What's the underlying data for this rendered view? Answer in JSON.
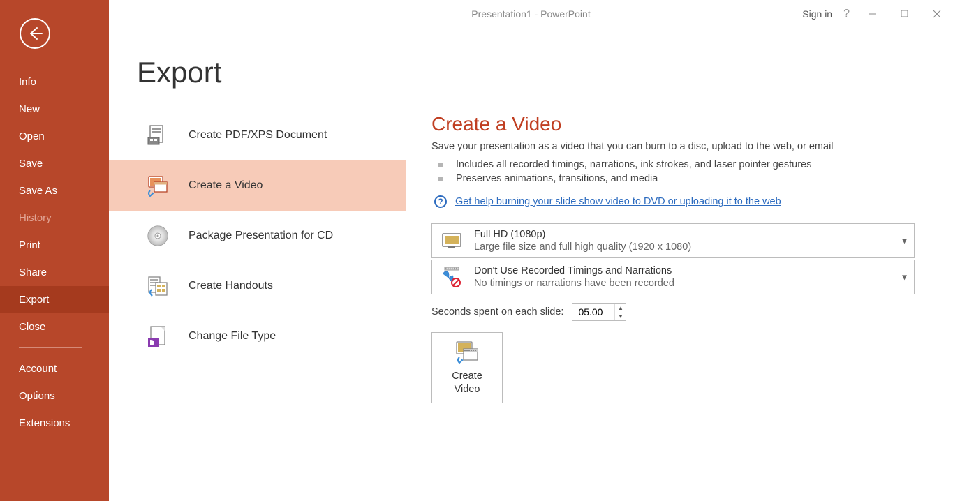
{
  "window": {
    "title": "Presentation1  -  PowerPoint",
    "signin": "Sign in",
    "help": "?"
  },
  "sidebar": {
    "items": [
      {
        "label": "Info",
        "selected": false,
        "disabled": false
      },
      {
        "label": "New",
        "selected": false,
        "disabled": false
      },
      {
        "label": "Open",
        "selected": false,
        "disabled": false
      },
      {
        "label": "Save",
        "selected": false,
        "disabled": false
      },
      {
        "label": "Save As",
        "selected": false,
        "disabled": false
      },
      {
        "label": "History",
        "selected": false,
        "disabled": true
      },
      {
        "label": "Print",
        "selected": false,
        "disabled": false
      },
      {
        "label": "Share",
        "selected": false,
        "disabled": false
      },
      {
        "label": "Export",
        "selected": true,
        "disabled": false
      },
      {
        "label": "Close",
        "selected": false,
        "disabled": false
      }
    ],
    "footer": [
      {
        "label": "Account"
      },
      {
        "label": "Options"
      },
      {
        "label": "Extensions"
      }
    ]
  },
  "page": {
    "title": "Export"
  },
  "export_options": [
    {
      "label": "Create PDF/XPS Document",
      "selected": false,
      "icon": "pdf-icon"
    },
    {
      "label": "Create a Video",
      "selected": true,
      "icon": "video-icon"
    },
    {
      "label": "Package Presentation for CD",
      "selected": false,
      "icon": "cd-icon"
    },
    {
      "label": "Create Handouts",
      "selected": false,
      "icon": "handouts-icon"
    },
    {
      "label": "Change File Type",
      "selected": false,
      "icon": "filetype-icon"
    }
  ],
  "detail": {
    "title": "Create a Video",
    "subtitle": "Save your presentation as a video that you can burn to a disc, upload to the web, or email",
    "bullets": [
      "Includes all recorded timings, narrations, ink strokes, and laser pointer gestures",
      "Preserves animations, transitions, and media"
    ],
    "help_link": "Get help burning your slide show video to DVD or uploading it to the web",
    "quality": {
      "title": "Full HD (1080p)",
      "sub": "Large file size and full high quality (1920 x 1080)"
    },
    "timings": {
      "title": "Don't Use Recorded Timings and Narrations",
      "sub": "No timings or narrations have been recorded"
    },
    "seconds_label": "Seconds spent on each slide:",
    "seconds_value": "05.00",
    "create_button_l1": "Create",
    "create_button_l2": "Video"
  }
}
